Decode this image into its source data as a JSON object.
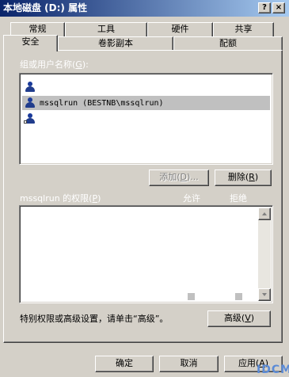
{
  "window": {
    "title": "本地磁盘 (D:) 属性",
    "help_glyph": "?",
    "close_glyph": "×"
  },
  "tabs": {
    "row1": [
      "常规",
      "工具",
      "硬件",
      "共享"
    ],
    "row2": [
      "安全",
      "卷影副本",
      "配额"
    ]
  },
  "security": {
    "group_label": "组或用户名称(",
    "group_hotkey": "G",
    "group_suffix": "):",
    "users": [
      {
        "name": ""
      },
      {
        "name": "mssqlrun (BESTNB\\mssqlrun)"
      },
      {
        "name": ""
      }
    ],
    "add_label": "添加(",
    "add_hotkey": "D",
    "add_suffix": ")...",
    "remove_label": "删除(",
    "remove_hotkey": "R",
    "remove_suffix": ")",
    "perm_label": "mssqlrun 的权限(",
    "perm_hotkey": "P",
    "perm_suffix": ")",
    "allow_col": "允许",
    "deny_col": "拒绝",
    "advanced_note": "特别权限或高级设置，请单击“高级”。",
    "advanced_label": "高级(",
    "advanced_hotkey": "V",
    "advanced_suffix": ")"
  },
  "footer": {
    "ok": "确定",
    "cancel": "取消",
    "apply_label": "应用(",
    "apply_hotkey": "A",
    "apply_suffix": ")"
  },
  "watermark": "IDCM",
  "colors": {
    "titlebar_start": "#0a246a",
    "titlebar_end": "#a6caf0",
    "face": "#d4d0c8",
    "selection": "#c0c0c0",
    "watermark": "#5b8bd6"
  }
}
